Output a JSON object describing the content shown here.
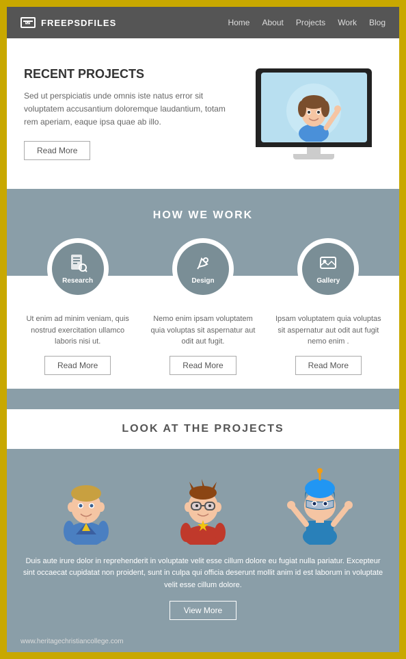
{
  "header": {
    "logo_text": "FREEPSDFILES",
    "nav_items": [
      "Home",
      "About",
      "Projects",
      "Work",
      "Blog"
    ]
  },
  "recent_projects": {
    "title_regular": "Recent",
    "title_bold": "PROJECTS",
    "description": "Sed ut perspiciatis unde omnis iste natus error sit voluptatem accusantium doloremque laudantium, totam rem aperiam, eaque ipsa quae ab illo.",
    "read_more_label": "Read More"
  },
  "how_we_work": {
    "section_title": "HOW WE WORK",
    "cards": [
      {
        "icon": "📰",
        "label": "Research",
        "desc": "Ut enim ad minim veniam, quis nostrud exercitation ullamco laboris nisi ut.",
        "read_more": "Read More"
      },
      {
        "icon": "✏️",
        "label": "Design",
        "desc": "Nemo enim ipsam voluptatem quia voluptas sit aspernatur aut odit aut fugit.",
        "read_more": "Read More"
      },
      {
        "icon": "🖼️",
        "label": "Gallery",
        "desc": "Ipsam voluptatem quia voluptas sit aspernatur aut odit aut fugit nemo enim .",
        "read_more": "Read More"
      }
    ]
  },
  "look_projects": {
    "section_title": "LOOK AT THE PROJECTS",
    "description": "Duis aute irure dolor in reprehenderit in voluptate velit esse cillum dolore eu fugiat nulla pariatur. Excepteur sint occaecat cupidatat non proident, sunt in culpa qui officia deserunt mollit anim id est laborum  in voluptate velit esse cillum dolore.",
    "view_more_label": "View More",
    "footer_link": "www.heritagechristiancollege.com"
  }
}
